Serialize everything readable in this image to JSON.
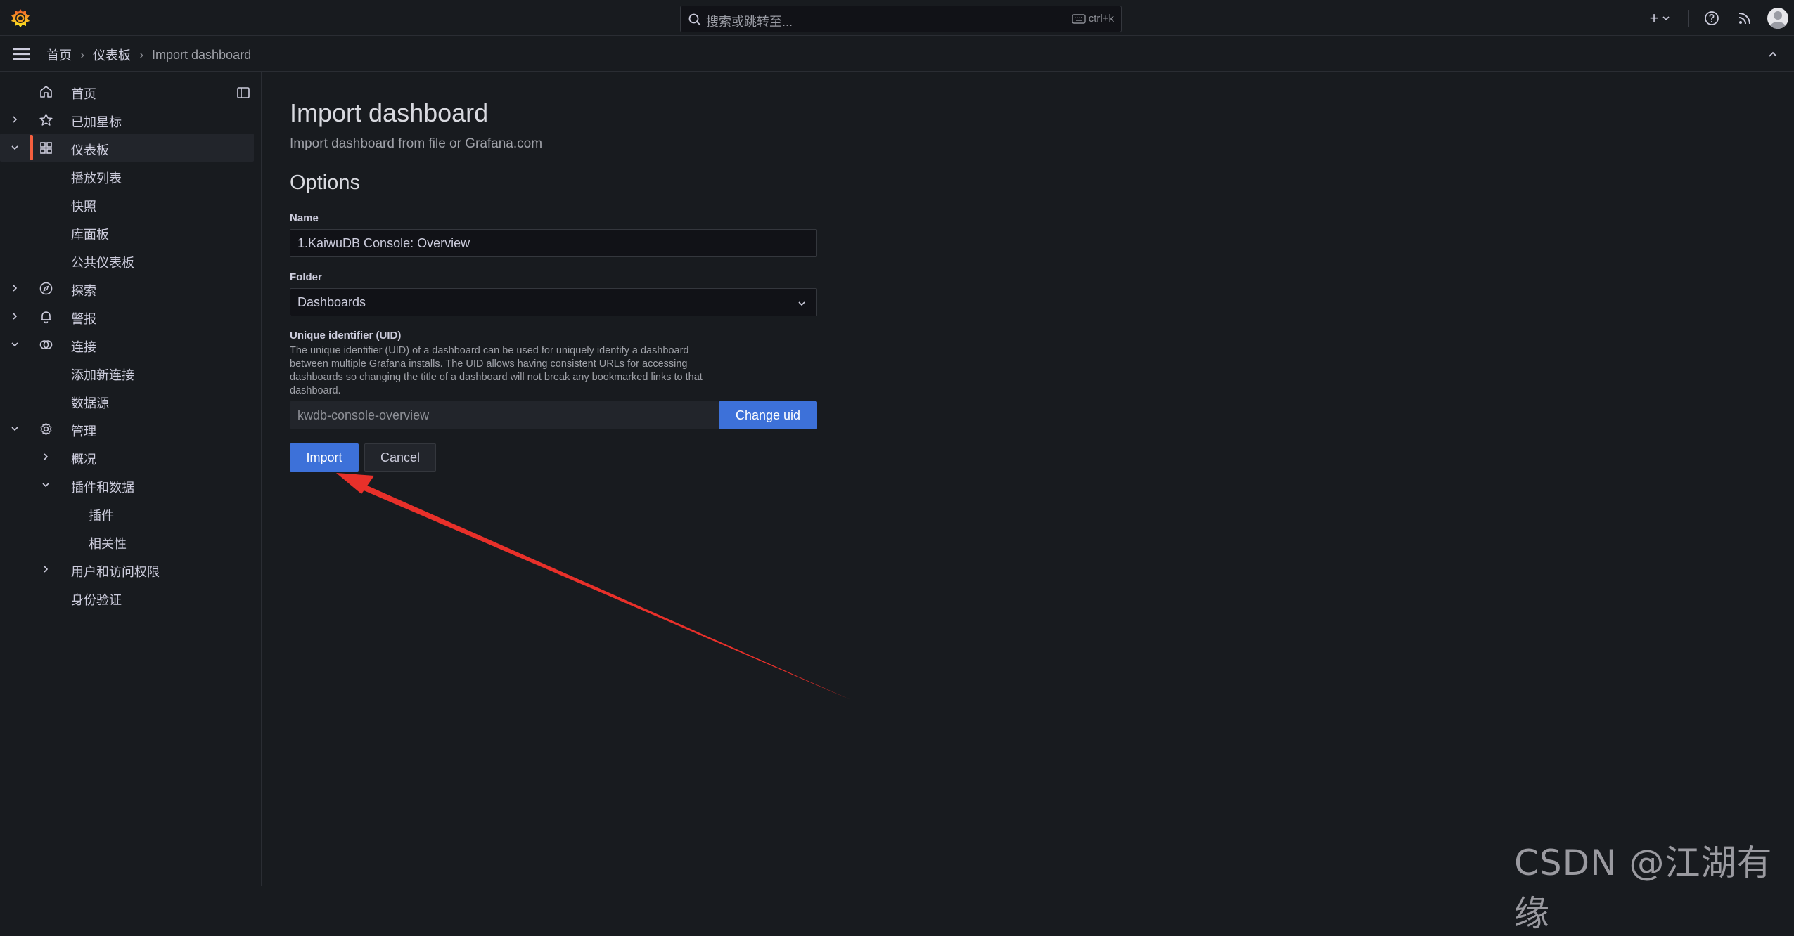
{
  "topbar": {
    "search_placeholder": "搜索或跳转至...",
    "search_shortcut": "ctrl+k",
    "plus_label": "+"
  },
  "breadcrumb": {
    "items": [
      "首页",
      "仪表板",
      "Import dashboard"
    ]
  },
  "sidebar": {
    "items": [
      {
        "label": "首页",
        "icon": "home-icon"
      },
      {
        "label": "已加星标",
        "icon": "star-icon"
      },
      {
        "label": "仪表板",
        "icon": "apps-icon"
      },
      {
        "label": "播放列表"
      },
      {
        "label": "快照"
      },
      {
        "label": "库面板"
      },
      {
        "label": "公共仪表板"
      },
      {
        "label": "探索",
        "icon": "compass-icon"
      },
      {
        "label": "警报",
        "icon": "bell-icon"
      },
      {
        "label": "连接",
        "icon": "connection-icon"
      },
      {
        "label": "添加新连接"
      },
      {
        "label": "数据源"
      },
      {
        "label": "管理",
        "icon": "cog-icon"
      },
      {
        "label": "概况"
      },
      {
        "label": "插件和数据"
      },
      {
        "label": "插件"
      },
      {
        "label": "相关性"
      },
      {
        "label": "用户和访问权限"
      },
      {
        "label": "身份验证"
      }
    ]
  },
  "main": {
    "title": "Import dashboard",
    "subtitle": "Import dashboard from file or Grafana.com",
    "options_title": "Options",
    "name_label": "Name",
    "name_value": "1.KaiwuDB Console: Overview",
    "folder_label": "Folder",
    "folder_value": "Dashboards",
    "uid_label": "Unique identifier (UID)",
    "uid_description": "The unique identifier (UID) of a dashboard can be used for uniquely identify a dashboard between multiple Grafana installs. The UID allows having consistent URLs for accessing dashboards so changing the title of a dashboard will not break any bookmarked links to that dashboard.",
    "uid_value": "kwdb-console-overview",
    "change_uid_label": "Change uid",
    "import_label": "Import",
    "cancel_label": "Cancel"
  },
  "watermark": "CSDN @江湖有缘",
  "colors": {
    "accent_orange": "#f55f3e",
    "primary_blue": "#3d71d9",
    "annotation_red": "#e8302a",
    "background": "#181b1f"
  }
}
